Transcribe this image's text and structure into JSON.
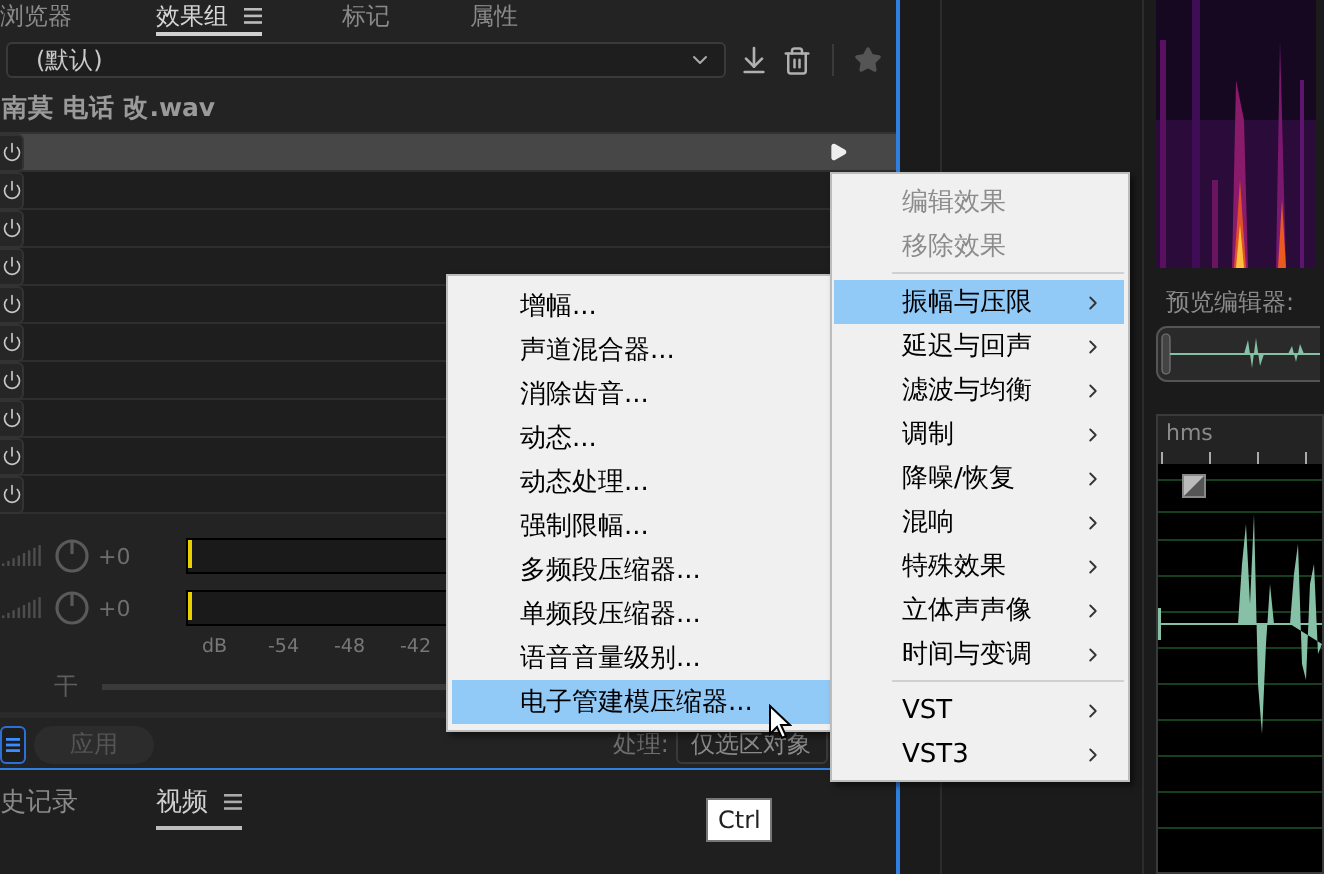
{
  "panel_tabs": [
    {
      "label": "浏览器",
      "selected": false,
      "menu": false
    },
    {
      "label": "效果组",
      "selected": true,
      "menu": true
    },
    {
      "label": "标记",
      "selected": false,
      "menu": false
    },
    {
      "label": "属性",
      "selected": false,
      "menu": false
    }
  ],
  "preset": {
    "value": "(默认)"
  },
  "file_name": "南莫 电话 改.wav",
  "rack_slots": [
    {
      "selected": true
    },
    {
      "selected": false
    },
    {
      "selected": false
    },
    {
      "selected": false
    },
    {
      "selected": false
    },
    {
      "selected": false
    },
    {
      "selected": false
    },
    {
      "selected": false
    },
    {
      "selected": false
    },
    {
      "selected": false
    }
  ],
  "meters": [
    {
      "gain": "+0"
    },
    {
      "gain": "+0"
    }
  ],
  "meter_scale": [
    "dB",
    "-54",
    "-48",
    "-42"
  ],
  "mix": {
    "label": "干"
  },
  "apply_button": "应用",
  "process": {
    "label": "处理:",
    "value": "仅选区对象"
  },
  "bottom_tabs": [
    {
      "label": "史记录",
      "selected": false,
      "menu": false
    },
    {
      "label": "视频",
      "selected": true,
      "menu": true
    }
  ],
  "preview_label": "预览编辑器:",
  "timeline": {
    "unit": "hms"
  },
  "context_menu": {
    "items": [
      {
        "kind": "item",
        "label": "编辑效果",
        "disabled": true,
        "selected": false,
        "submenu": false
      },
      {
        "kind": "item",
        "label": "移除效果",
        "disabled": true,
        "selected": false,
        "submenu": false
      },
      {
        "kind": "separator"
      },
      {
        "kind": "item",
        "label": "振幅与压限",
        "disabled": false,
        "selected": true,
        "submenu": true
      },
      {
        "kind": "item",
        "label": "延迟与回声",
        "disabled": false,
        "selected": false,
        "submenu": true
      },
      {
        "kind": "item",
        "label": "滤波与均衡",
        "disabled": false,
        "selected": false,
        "submenu": true
      },
      {
        "kind": "item",
        "label": "调制",
        "disabled": false,
        "selected": false,
        "submenu": true
      },
      {
        "kind": "item",
        "label": "降噪/恢复",
        "disabled": false,
        "selected": false,
        "submenu": true
      },
      {
        "kind": "item",
        "label": "混响",
        "disabled": false,
        "selected": false,
        "submenu": true
      },
      {
        "kind": "item",
        "label": "特殊效果",
        "disabled": false,
        "selected": false,
        "submenu": true
      },
      {
        "kind": "item",
        "label": "立体声声像",
        "disabled": false,
        "selected": false,
        "submenu": true
      },
      {
        "kind": "item",
        "label": "时间与变调",
        "disabled": false,
        "selected": false,
        "submenu": true
      },
      {
        "kind": "separator"
      },
      {
        "kind": "item",
        "label": "VST",
        "disabled": false,
        "selected": false,
        "submenu": true
      },
      {
        "kind": "item",
        "label": "VST3",
        "disabled": false,
        "selected": false,
        "submenu": true
      }
    ]
  },
  "submenu": {
    "items": [
      {
        "label": "增幅...",
        "selected": false
      },
      {
        "label": "声道混合器...",
        "selected": false
      },
      {
        "label": "消除齿音...",
        "selected": false
      },
      {
        "label": "动态...",
        "selected": false
      },
      {
        "label": "动态处理...",
        "selected": false
      },
      {
        "label": "强制限幅...",
        "selected": false
      },
      {
        "label": "多频段压缩器...",
        "selected": false
      },
      {
        "label": "单频段压缩器...",
        "selected": false
      },
      {
        "label": "语音音量级别...",
        "selected": false
      },
      {
        "label": "电子管建模压缩器...",
        "selected": true
      }
    ]
  },
  "tooltip": "Ctrl"
}
